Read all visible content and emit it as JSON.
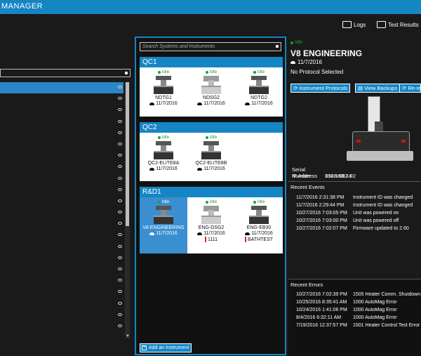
{
  "app": {
    "title": "MANAGER"
  },
  "toolbar": {
    "logs_label": "Logs",
    "results_label": "Test Results"
  },
  "systems": {
    "search_placeholder": "Search Systems and Instruments",
    "add_label": "Add an Instrument",
    "groups": [
      {
        "name": "QC1",
        "instruments": [
          {
            "status": "Idle",
            "name": "NDTG1",
            "date": "11/7/2016"
          },
          {
            "status": "Idle",
            "name": "NDSG2",
            "date": "11/7/2016"
          },
          {
            "status": "Idle",
            "name": "NDTG2",
            "date": "11/7/2016"
          }
        ]
      },
      {
        "name": "QC2",
        "instruments": [
          {
            "status": "Idle",
            "name": "QC2-ELITE8A",
            "date": "11/7/2016"
          },
          {
            "status": "Idle",
            "name": "QC2-ELITE8B",
            "date": "11/7/2016"
          }
        ]
      },
      {
        "name": "R&D1",
        "instruments": [
          {
            "status": "Idle",
            "name": "V8 ENGINEERING",
            "date": "11/7/2016"
          },
          {
            "status": "Idle",
            "name": "ENG-DSG2",
            "date": "11/7/2016",
            "tag": "1111"
          },
          {
            "status": "Idle",
            "name": "ENG-EB30",
            "date": "11/7/2016",
            "tag": "BATHTEST"
          }
        ]
      }
    ]
  },
  "details": {
    "status": "Idle",
    "name": "V8 ENGINEERING",
    "date": "11/7/2016",
    "protocol": "No Protocol Selected",
    "buttons": {
      "protocols": "Instrument Protocols",
      "backups": "View Backups",
      "reregister": "Re-re"
    },
    "serial_label": "Serial Number",
    "serial_value": "0388-EB24",
    "ip_label": "IP Address",
    "ip_value": "192.168.1.92",
    "events_title": "Recent Events",
    "events": [
      {
        "ts": "11/7/2016 2:31:38 PM",
        "msg": "Instrument ID was changed"
      },
      {
        "ts": "11/7/2016 2:29:44 PM",
        "msg": "Instrument ID was changed"
      },
      {
        "ts": "10/27/2016 7:03:05 PM",
        "msg": "Unit was powered on"
      },
      {
        "ts": "10/27/2016 7:03:00 PM",
        "msg": "Unit was powered off"
      },
      {
        "ts": "10/27/2016 7:02:07 PM",
        "msg": "Firmware updated to 2.60"
      }
    ],
    "errors_title": "Recent Errors",
    "errors": [
      {
        "ts": "10/27/2016 7:02:39 PM",
        "msg": "1505 Heater Comm. Shutdown"
      },
      {
        "ts": "10/25/2016 8:35:41 AM",
        "msg": "1000 AutoMag Error"
      },
      {
        "ts": "10/24/2016 1:41:06 PM",
        "msg": "1000 AutoMag Error"
      },
      {
        "ts": "8/4/2016 6:32:11 AM",
        "msg": "1000 AutoMag Error"
      },
      {
        "ts": "7/19/2016 12:37:57 PM",
        "msg": "1501 Heater Control Test Error"
      }
    ]
  },
  "colors": {
    "accent": "#1585c4",
    "idle": "#1c9e3c",
    "tag": "#e2231a"
  }
}
